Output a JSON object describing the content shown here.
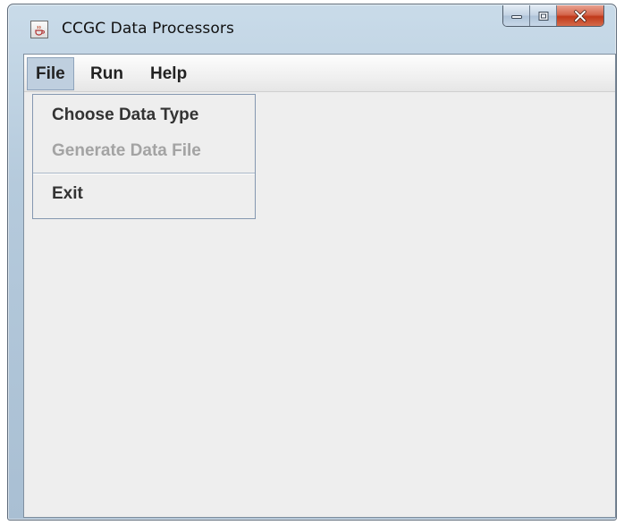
{
  "window": {
    "title": "CCGC Data Processors",
    "app_icon": "java-cup-icon",
    "controls": [
      "minimize-icon",
      "maximize-icon",
      "close-icon"
    ]
  },
  "menubar": {
    "items": [
      {
        "label": "File",
        "active": true
      },
      {
        "label": "Run",
        "active": false
      },
      {
        "label": "Help",
        "active": false
      }
    ]
  },
  "file_menu": {
    "items": [
      {
        "label": "Choose Data Type",
        "enabled": true
      },
      {
        "label": "Generate Data File",
        "enabled": false
      },
      {
        "label": "Exit",
        "enabled": true
      }
    ]
  },
  "colors": {
    "frame": "#b5cadc",
    "client_bg": "#eeeeee",
    "menu_active": "#bfcfdf",
    "close_button": "#c0391a",
    "disabled_text": "#a3a3a3"
  }
}
